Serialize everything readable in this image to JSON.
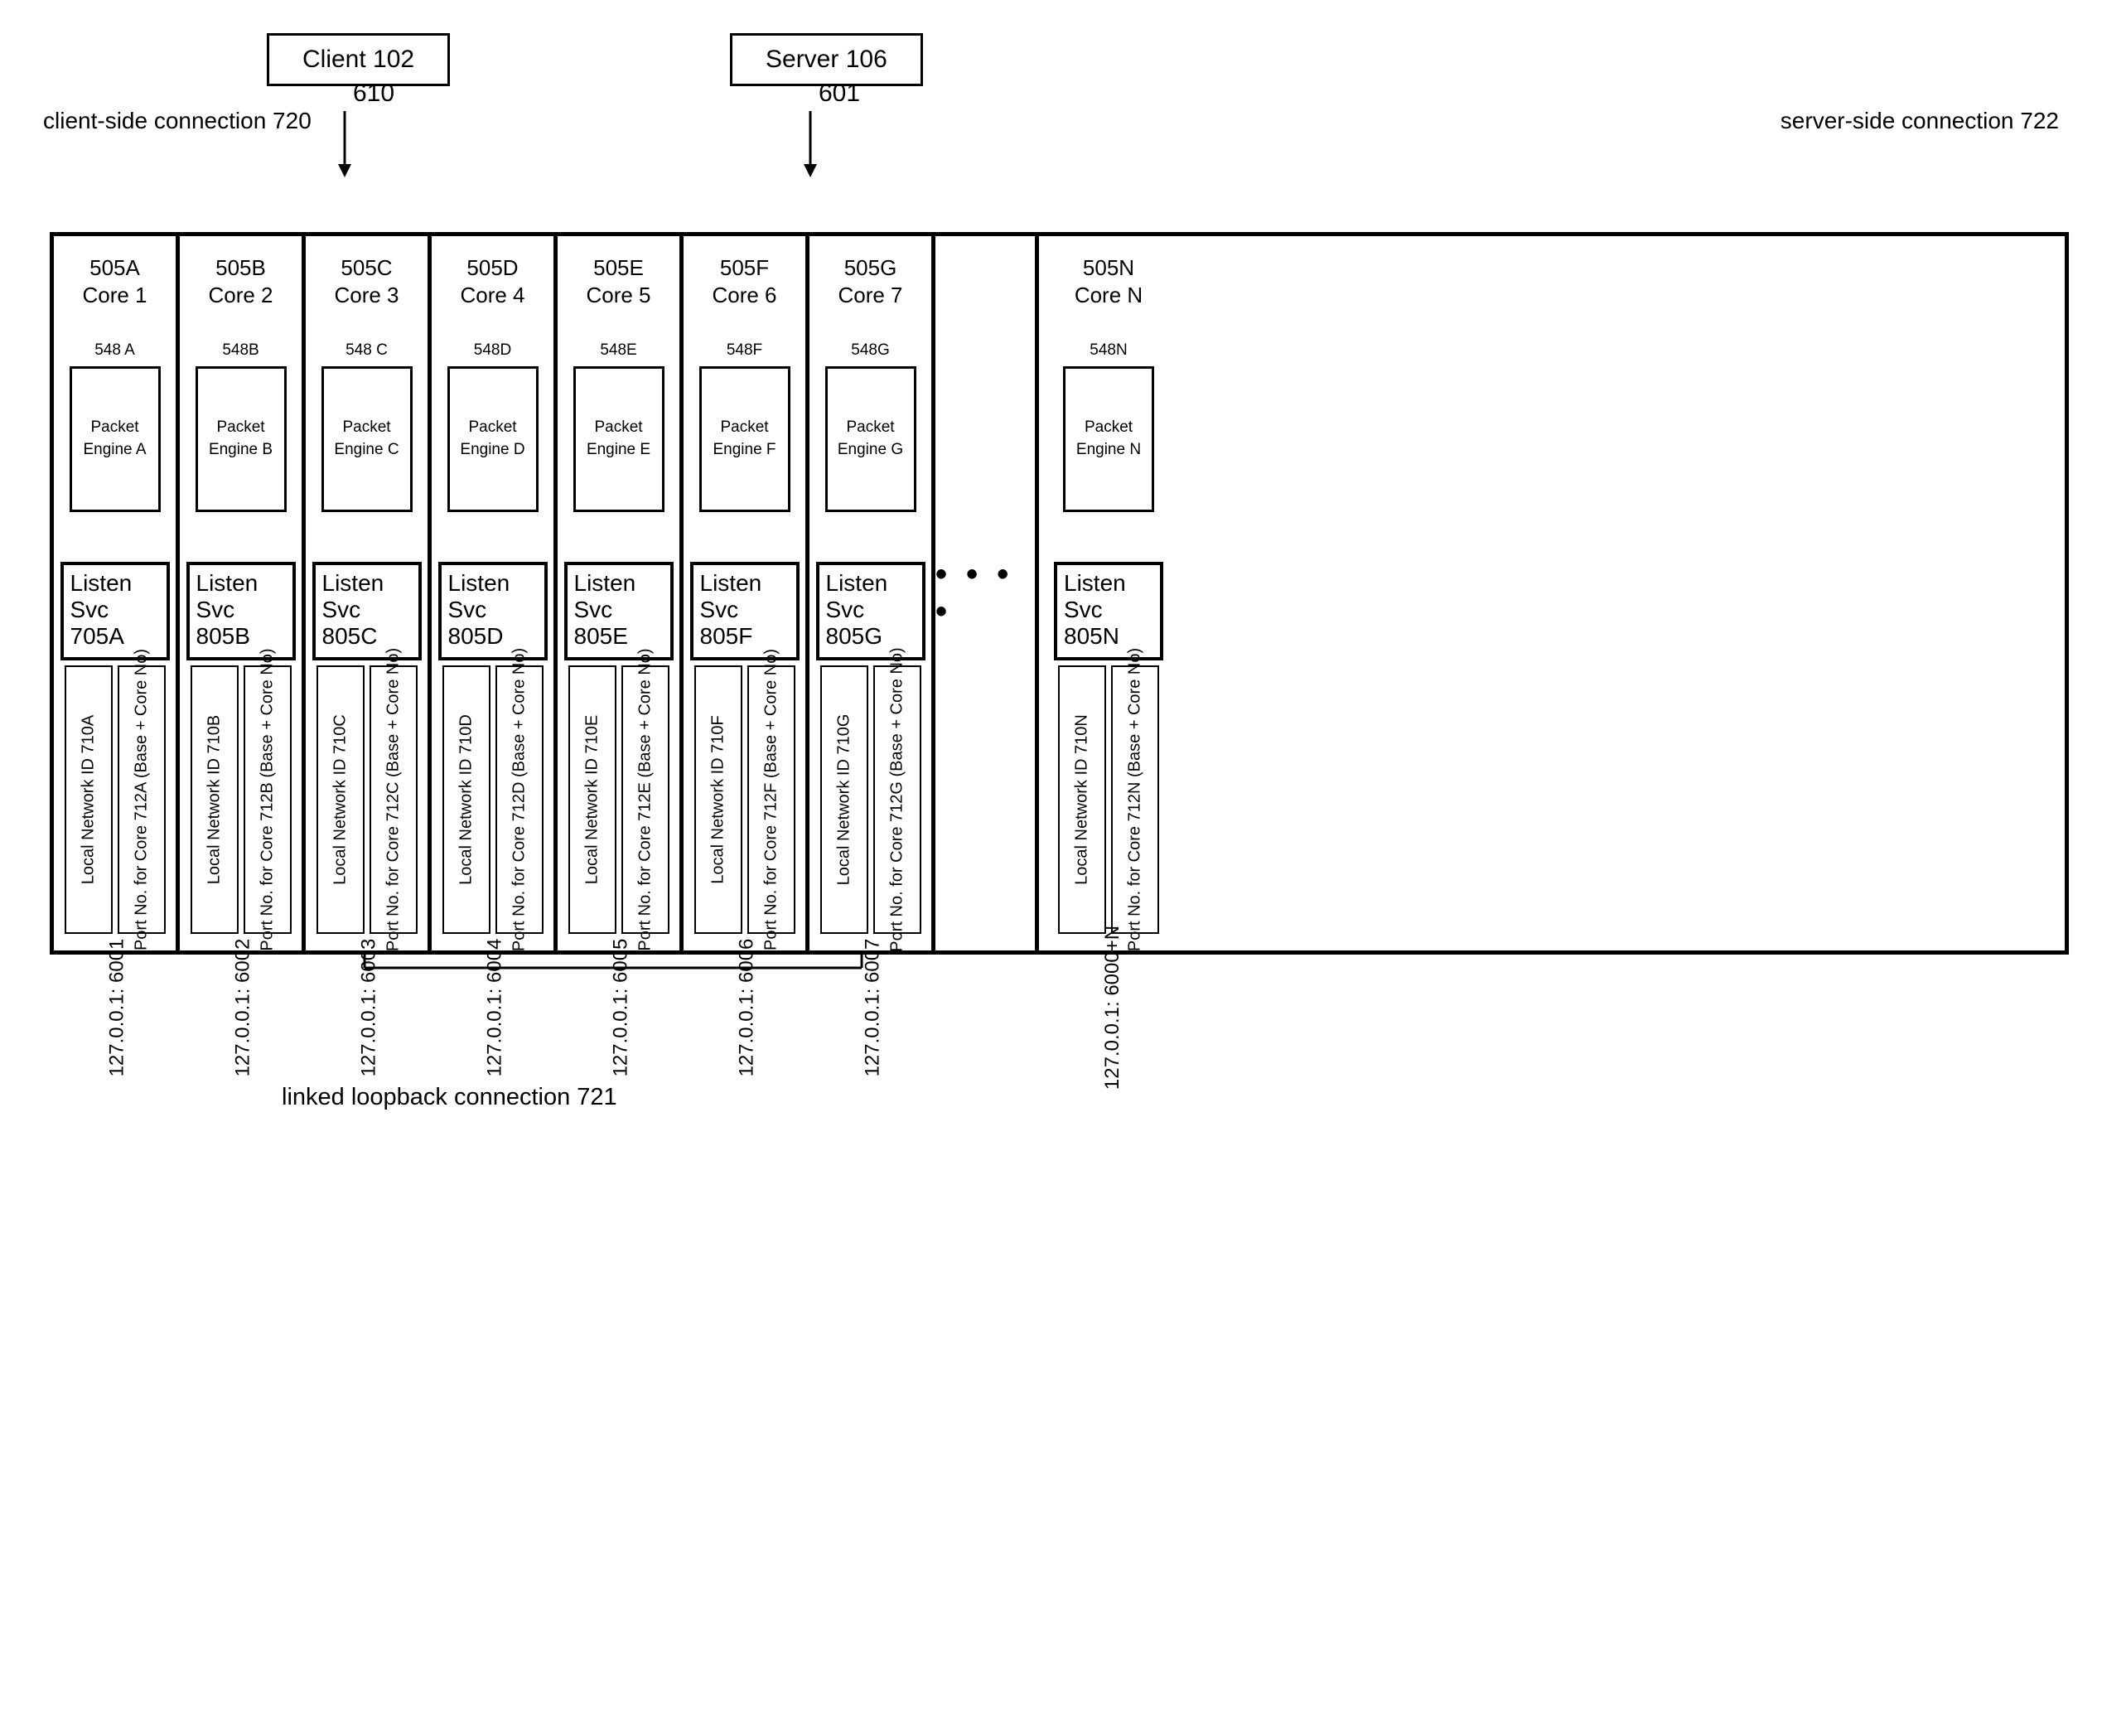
{
  "client": {
    "label": "Client 102"
  },
  "server": {
    "label": "Server 106"
  },
  "clientConn": "client-side connection 720",
  "serverConn": "server-side connection 722",
  "arrowLeft": "610",
  "arrowRight": "601",
  "loopback": "linked loopback connection 721",
  "ellipsis": "• • • •",
  "cores": [
    {
      "hdr1": "505A",
      "hdr2": "Core 1",
      "peLab": "548 A",
      "pe": "Packet Engine A",
      "ls1": "Listen",
      "ls2": "Svc",
      "ls3": "705A",
      "v1": "Local Network ID 710A",
      "v2": "Port No. for Core 712A (Base + Core No)",
      "ip": "127.0.0.1: 6001"
    },
    {
      "hdr1": "505B",
      "hdr2": "Core 2",
      "peLab": "548B",
      "pe": "Packet Engine B",
      "ls1": "Listen",
      "ls2": "Svc",
      "ls3": "805B",
      "v1": "Local Network ID 710B",
      "v2": "Port No. for Core 712B (Base + Core No)",
      "ip": "127.0.0.1: 6002"
    },
    {
      "hdr1": "505C",
      "hdr2": "Core 3",
      "peLab": "548 C",
      "pe": "Packet Engine C",
      "ls1": "Listen",
      "ls2": "Svc",
      "ls3": "805C",
      "v1": "Local Network ID 710C",
      "v2": "Port No. for Core 712C (Base + Core No)",
      "ip": "127.0.0.1: 6003"
    },
    {
      "hdr1": "505D",
      "hdr2": "Core 4",
      "peLab": "548D",
      "pe": "Packet Engine D",
      "ls1": "Listen",
      "ls2": "Svc",
      "ls3": "805D",
      "v1": "Local Network ID 710D",
      "v2": "Port No. for Core 712D (Base + Core No)",
      "ip": "127.0.0.1: 6004"
    },
    {
      "hdr1": "505E",
      "hdr2": "Core 5",
      "peLab": "548E",
      "pe": "Packet Engine E",
      "ls1": "Listen",
      "ls2": "Svc",
      "ls3": "805E",
      "v1": "Local Network ID 710E",
      "v2": "Port No. for Core 712E (Base + Core No)",
      "ip": "127.0.0.1: 6005"
    },
    {
      "hdr1": "505F",
      "hdr2": "Core 6",
      "peLab": "548F",
      "pe": "Packet Engine F",
      "ls1": "Listen",
      "ls2": "Svc",
      "ls3": "805F",
      "v1": "Local Network ID 710F",
      "v2": "Port No. for Core 712F (Base + Core No)",
      "ip": "127.0.0.1: 6006"
    },
    {
      "hdr1": "505G",
      "hdr2": "Core 7",
      "peLab": "548G",
      "pe": "Packet Engine G",
      "ls1": "Listen",
      "ls2": "Svc",
      "ls3": "805G",
      "v1": "Local Network ID 710G",
      "v2": "Port No. for Core 712G (Base + Core No)",
      "ip": "127.0.0.1: 6007"
    },
    {
      "hdr1": "505N",
      "hdr2": "Core N",
      "peLab": "548N",
      "pe": "Packet Engine N",
      "ls1": "Listen",
      "ls2": "Svc",
      "ls3": "805N",
      "v1": "Local Network ID 710N",
      "v2": "Port No. for Core 712N (Base + Core No)",
      "ip": "127.0.0.1: 6000+N"
    }
  ]
}
